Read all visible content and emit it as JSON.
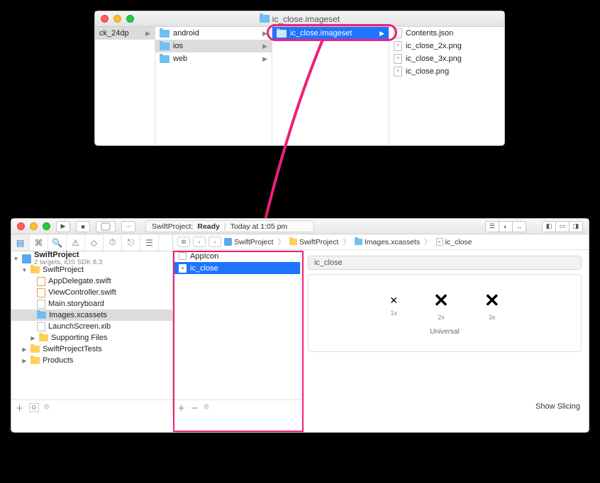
{
  "finder": {
    "title": "ic_close.imageset",
    "col0": {
      "item": "ck_24dp"
    },
    "col1": {
      "android": "android",
      "ios": "ios",
      "web": "web"
    },
    "col2": {
      "imageset": "ic_close.imageset"
    },
    "col3": {
      "contents": "Contents.json",
      "img2x": "ic_close_2x.png",
      "img3x": "ic_close_3x.png",
      "img1x": "ic_close.png"
    }
  },
  "xcode": {
    "status_project": "SwiftProject:",
    "status_state": "Ready",
    "status_sep": "|",
    "status_time": "Today at 1:05 pm",
    "breadcrumb": {
      "proj": "SwiftProject",
      "grp": "SwiftProject",
      "assets": "Images.xcassets",
      "asset": "ic_close"
    },
    "tree": {
      "root": "SwiftProject",
      "root_sub": "2 targets, iOS SDK 8.3",
      "grp": "SwiftProject",
      "appdelegate": "AppDelegate.swift",
      "viewcontroller": "ViewController.swift",
      "storyboard": "Main.storyboard",
      "images": "Images.xcassets",
      "launch": "LaunchScreen.xib",
      "supporting": "Supporting Files",
      "tests": "SwiftProjectTests",
      "products": "Products"
    },
    "assets": {
      "appicon": "AppIcon",
      "icclose": "ic_close",
      "preview_name": "ic_close",
      "s1": "1x",
      "s2": "2x",
      "s3": "3x",
      "universal": "Universal",
      "show_slicing": "Show Slicing"
    }
  }
}
